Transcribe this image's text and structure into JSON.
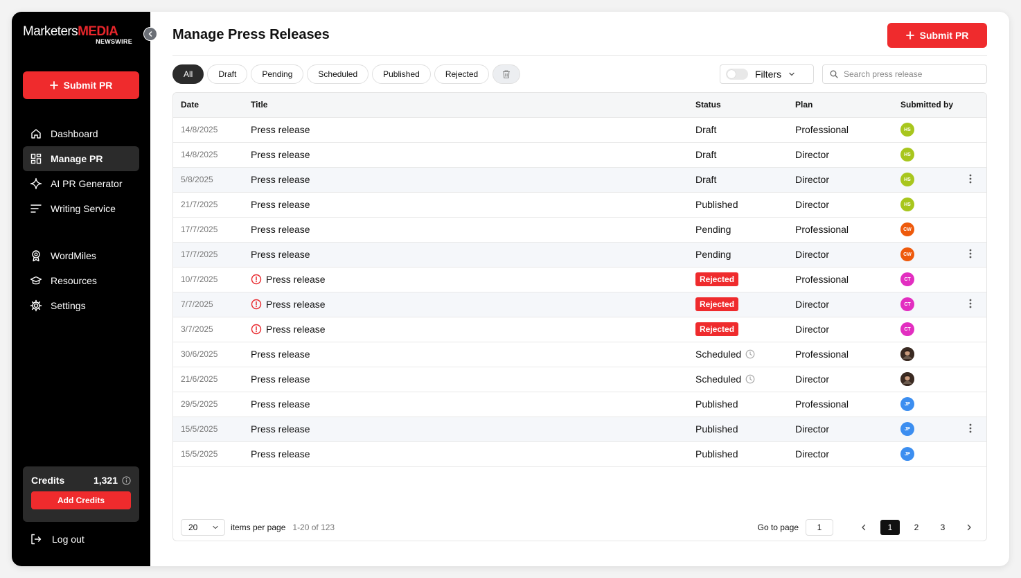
{
  "brand": {
    "name_part1": "Marketers",
    "name_part2": "MEDIA",
    "tagline": "NEWSWIRE"
  },
  "sidebar": {
    "submit_label": "Submit PR",
    "items": [
      {
        "label": "Dashboard",
        "icon": "home-icon"
      },
      {
        "label": "Manage PR",
        "icon": "grid-icon",
        "active": true
      },
      {
        "label": "AI PR Generator",
        "icon": "sparkle-icon"
      },
      {
        "label": "Writing Service",
        "icon": "lines-icon"
      }
    ],
    "items2": [
      {
        "label": "WordMiles",
        "icon": "award-icon"
      },
      {
        "label": "Resources",
        "icon": "graduation-cap-icon"
      },
      {
        "label": "Settings",
        "icon": "gear-icon"
      }
    ],
    "credits": {
      "label": "Credits",
      "value": "1,321",
      "button": "Add Credits"
    },
    "logout_label": "Log out"
  },
  "header": {
    "title": "Manage Press Releases",
    "submit_label": "Submit PR"
  },
  "tabs": [
    "All",
    "Draft",
    "Pending",
    "Scheduled",
    "Published",
    "Rejected"
  ],
  "filters_label": "Filters",
  "search": {
    "placeholder": "Search press release",
    "value": ""
  },
  "table": {
    "columns": [
      "Date",
      "Title",
      "Status",
      "Plan",
      "Submitted by"
    ],
    "rows": [
      {
        "date": "14/8/2025",
        "title": "Press release",
        "status": "Draft",
        "plan": "Professional",
        "initials": "HS",
        "color": "#a8c61d",
        "hl": false,
        "menu": false,
        "rejected": false,
        "scheduled": false
      },
      {
        "date": "14/8/2025",
        "title": "Press release",
        "status": "Draft",
        "plan": "Director",
        "initials": "HS",
        "color": "#a8c61d",
        "hl": false,
        "menu": false,
        "rejected": false,
        "scheduled": false
      },
      {
        "date": "5/8/2025",
        "title": "Press release",
        "status": "Draft",
        "plan": "Director",
        "initials": "HS",
        "color": "#a8c61d",
        "hl": true,
        "menu": true,
        "rejected": false,
        "scheduled": false
      },
      {
        "date": "21/7/2025",
        "title": "Press release",
        "status": "Published",
        "plan": "Director",
        "initials": "HS",
        "color": "#a8c61d",
        "hl": false,
        "menu": false,
        "rejected": false,
        "scheduled": false
      },
      {
        "date": "17/7/2025",
        "title": "Press release",
        "status": "Pending",
        "plan": "Professional",
        "initials": "CW",
        "color": "#ee5a0c",
        "hl": false,
        "menu": false,
        "rejected": false,
        "scheduled": false
      },
      {
        "date": "17/7/2025",
        "title": "Press release",
        "status": "Pending",
        "plan": "Director",
        "initials": "CW",
        "color": "#ee5a0c",
        "hl": true,
        "menu": true,
        "rejected": false,
        "scheduled": false
      },
      {
        "date": "10/7/2025",
        "title": "Press release",
        "status": "Rejected",
        "plan": "Professional",
        "initials": "CT",
        "color": "#e22ec0",
        "hl": false,
        "menu": false,
        "rejected": true,
        "scheduled": false
      },
      {
        "date": "7/7/2025",
        "title": "Press release",
        "status": "Rejected",
        "plan": "Director",
        "initials": "CT",
        "color": "#e22ec0",
        "hl": true,
        "menu": true,
        "rejected": true,
        "scheduled": false
      },
      {
        "date": "3/7/2025",
        "title": "Press release",
        "status": "Rejected",
        "plan": "Director",
        "initials": "CT",
        "color": "#e22ec0",
        "hl": false,
        "menu": false,
        "rejected": true,
        "scheduled": false
      },
      {
        "date": "30/6/2025",
        "title": "Press release",
        "status": "Scheduled",
        "plan": "Professional",
        "initials": "",
        "color": "#5a4236",
        "hl": false,
        "menu": false,
        "rejected": false,
        "scheduled": true
      },
      {
        "date": "21/6/2025",
        "title": "Press release",
        "status": "Scheduled",
        "plan": "Director",
        "initials": "",
        "color": "#5a4236",
        "hl": false,
        "menu": false,
        "rejected": false,
        "scheduled": true
      },
      {
        "date": "29/5/2025",
        "title": "Press release",
        "status": "Published",
        "plan": "Professional",
        "initials": "JF",
        "color": "#3c8ef0",
        "hl": false,
        "menu": false,
        "rejected": false,
        "scheduled": false
      },
      {
        "date": "15/5/2025",
        "title": "Press release",
        "status": "Published",
        "plan": "Director",
        "initials": "JF",
        "color": "#3c8ef0",
        "hl": true,
        "menu": true,
        "rejected": false,
        "scheduled": false
      },
      {
        "date": "15/5/2025",
        "title": "Press release",
        "status": "Published",
        "plan": "Director",
        "initials": "JF",
        "color": "#3c8ef0",
        "hl": false,
        "menu": false,
        "rejected": false,
        "scheduled": false
      }
    ]
  },
  "pagination": {
    "page_size": "20",
    "items_label": "items per page",
    "range": "1-20 of 123",
    "goto_label": "Go to page",
    "goto_value": "1",
    "pages": [
      "1",
      "2",
      "3"
    ],
    "current": "1"
  },
  "colors": {
    "accent": "#ef2b2d",
    "sidebar_bg": "#000000"
  }
}
